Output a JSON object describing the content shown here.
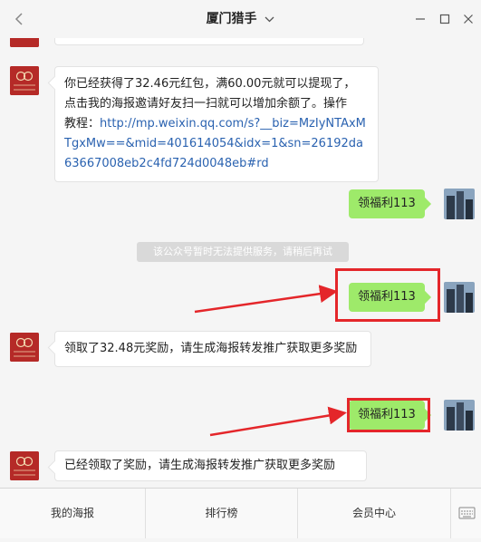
{
  "window": {
    "title": "厦门猎手",
    "controls": [
      "minimize-icon",
      "maximize-icon",
      "close-icon"
    ]
  },
  "messages": [
    {
      "from": "bot",
      "text_line1": "你已经获得了32.46元红包，满60.00元就可以提现了，",
      "text_line2": "点击我的海报邀请好友扫一扫就可以增加余额了。操作",
      "text_line3": "教程：",
      "link": "http://mp.weixin.qq.com/s?__biz=MzIyNTAxMTgxMw==&mid=401614054&idx=1&sn=26192da63667008eb2c4fd724d0048eb#rd"
    },
    {
      "from": "user",
      "text": "领福利113"
    },
    {
      "from": "system",
      "text": "该公众号暂时无法提供服务，请稍后再试"
    },
    {
      "from": "user",
      "text": "领福利113",
      "highlighted": true
    },
    {
      "from": "bot",
      "text": "领取了32.48元奖励，请生成海报转发推广获取更多奖励"
    },
    {
      "from": "user",
      "text": "领福利113",
      "highlighted": true
    },
    {
      "from": "bot",
      "text": "已经领取了奖励，请生成海报转发推广获取更多奖励"
    }
  ],
  "menu": {
    "items": [
      "我的海报",
      "排行榜",
      "会员中心"
    ],
    "keyboard_icon": "keyboard-icon"
  },
  "colors": {
    "user_bubble": "#9eea6a",
    "highlight": "#e4262a",
    "bot_avatar": "#b52a27",
    "link": "#2a62b0"
  }
}
